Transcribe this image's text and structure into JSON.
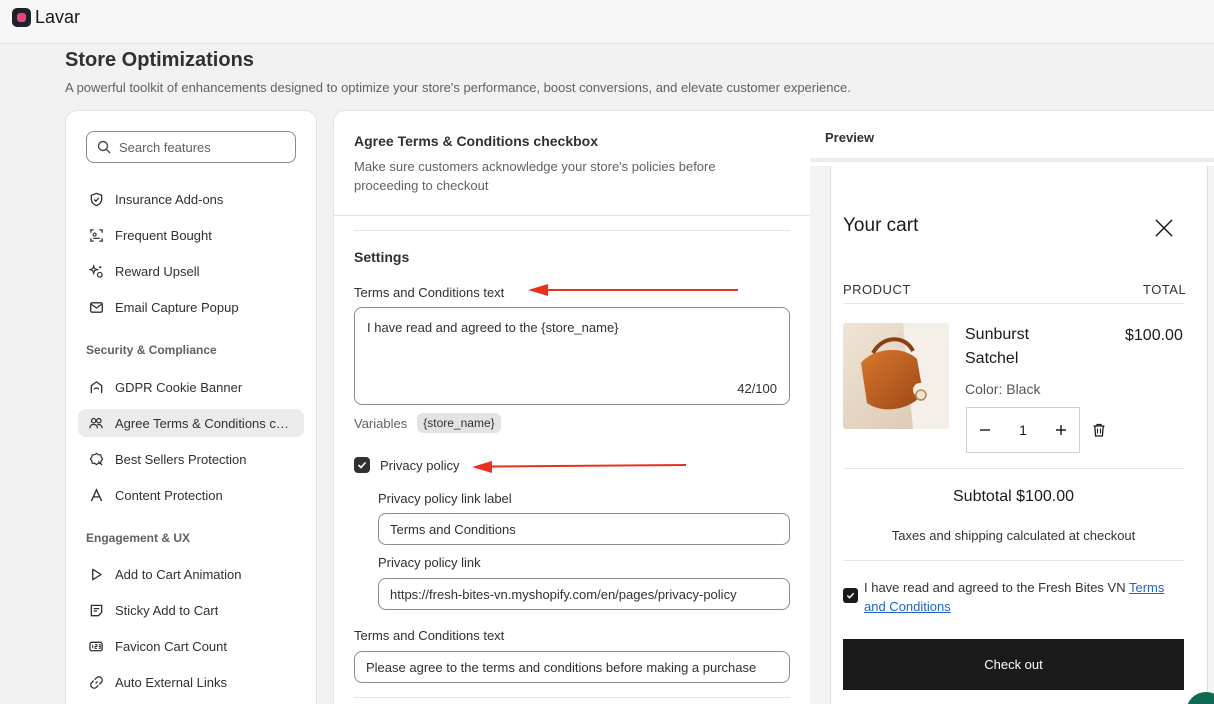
{
  "app": {
    "name": "Lavar"
  },
  "page": {
    "title": "Store Optimizations",
    "subtitle": "A powerful toolkit of enhancements designed to optimize your store's performance, boost conversions, and elevate customer experience."
  },
  "sidebar": {
    "search_placeholder": "Search features",
    "items_top": [
      {
        "label": "Insurance Add-ons",
        "icon": "shield-check-icon"
      },
      {
        "label": "Frequent Bought",
        "icon": "scan-icon"
      },
      {
        "label": "Reward Upsell",
        "icon": "sparkle-icon"
      },
      {
        "label": "Email Capture Popup",
        "icon": "email-icon"
      }
    ],
    "groups": [
      {
        "title": "Security & Compliance",
        "items": [
          {
            "label": "GDPR Cookie Banner",
            "icon": "cookie-shield-icon"
          },
          {
            "label": "Agree Terms & Conditions checkbox",
            "icon": "people-icon",
            "active": true
          },
          {
            "label": "Best Sellers Protection",
            "icon": "badge-icon"
          },
          {
            "label": "Content Protection",
            "icon": "text-icon"
          }
        ]
      },
      {
        "title": "Engagement & UX",
        "items": [
          {
            "label": "Add to Cart Animation",
            "icon": "play-icon"
          },
          {
            "label": "Sticky Add to Cart",
            "icon": "sticky-note-icon"
          },
          {
            "label": "Favicon Cart Count",
            "icon": "counter-icon"
          },
          {
            "label": "Auto External Links",
            "icon": "link-icon"
          }
        ]
      }
    ]
  },
  "feature": {
    "title": "Agree Terms & Conditions checkbox",
    "description": "Make sure customers acknowledge your store's policies before proceeding to checkout",
    "settings_title": "Settings",
    "terms_label": "Terms and Conditions text",
    "terms_value": "I have read and agreed to the {store_name}",
    "terms_counter": "42/100",
    "variables_label": "Variables",
    "variable_chip": "{store_name}",
    "privacy_checkbox_label": "Privacy policy",
    "privacy_checked": true,
    "privacy_link_label_label": "Privacy policy link label",
    "privacy_link_label_value": "Terms and Conditions",
    "privacy_link_label": "Privacy policy link",
    "privacy_link_value": "https://fresh-bites-vn.myshopify.com/en/pages/privacy-policy",
    "error_text_label": "Terms and Conditions text",
    "error_text_value": "Please agree to the terms and conditions before making a purchase"
  },
  "preview": {
    "title": "Preview",
    "cart_title": "Your cart",
    "col_product": "PRODUCT",
    "col_total": "TOTAL",
    "product_name": "Sunburst Satchel",
    "product_price": "$100.00",
    "product_variant": "Color: Black",
    "quantity": "1",
    "subtotal": "Subtotal $100.00",
    "taxes_note": "Taxes and shipping calculated at checkout",
    "agree_text": "I have read and agreed to the Fresh Bites VN ",
    "agree_link": "Terms and Conditions",
    "checkout_label": "Check out"
  },
  "colors": {
    "annotation_arrow": "#e8321e",
    "checkout_bg": "#1a1a1a",
    "link": "#1f63c6",
    "active_nav": "#ebebeb"
  }
}
